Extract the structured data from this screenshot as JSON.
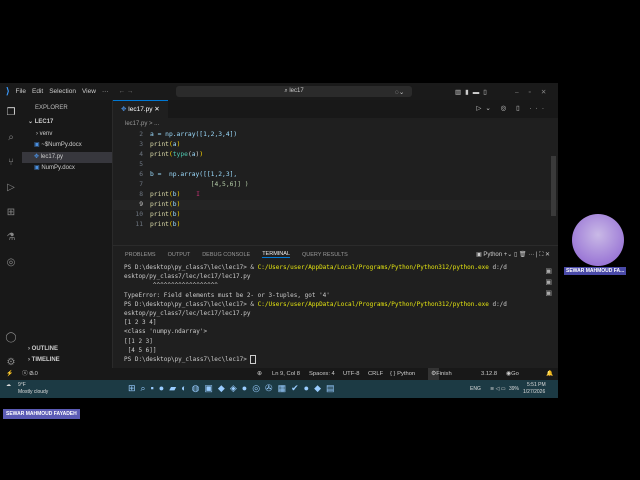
{
  "menu": [
    "File",
    "Edit",
    "Selection",
    "View",
    "···"
  ],
  "search": "lec17",
  "explorer": {
    "title": "EXPLORER",
    "folder": "LEC17",
    "items": [
      "venv",
      "~$NumPy.docx",
      "lec17.py",
      "NumPy.docx"
    ],
    "outline": "OUTLINE",
    "timeline": "TIMELINE"
  },
  "tab": "lec17.py",
  "breadcrumb": "lec17.py > ...",
  "code": [
    {
      "n": "2",
      "t": "a = np.array([1,2,3,4])"
    },
    {
      "n": "3",
      "t": "print(a)"
    },
    {
      "n": "4",
      "t": "print(type(a))"
    },
    {
      "n": "5",
      "t": ""
    },
    {
      "n": "6",
      "t": "b =  np.array([[1,2,3],"
    },
    {
      "n": "7",
      "t": "                [4,5,6]] )"
    },
    {
      "n": "8",
      "t": "print(b)"
    },
    {
      "n": "9",
      "t": "print(b)"
    },
    {
      "n": "10",
      "t": "print(b)"
    },
    {
      "n": "11",
      "t": "print(b)"
    }
  ],
  "panel_tabs": [
    "PROBLEMS",
    "OUTPUT",
    "DEBUG CONSOLE",
    "TERMINAL",
    "QUERY RESULTS"
  ],
  "terminal_shell": "Python",
  "terminal": {
    "l1a": "PS D:\\desktop\\py_class7\\lec\\lec17> & ",
    "l1b": "C:/Users/user/AppData/Local/Programs/Python/Python312/python.exe",
    "l1c": " d:/d",
    "l2": "esktop/py_class7/lec/lec17/lec17.py",
    "l3": "        ^^^^^^^^^^^^^^^^^^",
    "l4": "TypeError: Field elements must be 2- or 3-tuples, got '4'",
    "l5a": "PS D:\\desktop\\py_class7\\lec\\lec17> & ",
    "l5b": "C:/Users/user/AppData/Local/Programs/Python/Python312/python.exe",
    "l5c": " d:/d",
    "l6": "esktop/py_class7/lec/lec17/lec17.py",
    "l7": "[1 2 3 4]",
    "l8": "<class 'numpy.ndarray'>",
    "l9": "[[1 2 3]",
    "l10": " [4 5 6]]",
    "l11": "PS D:\\desktop\\py_class7\\lec\\lec17> "
  },
  "status": {
    "errors": "0",
    "warnings": "0",
    "pos": "Ln 9, Col 8",
    "spaces": "Spaces: 4",
    "enc": "UTF-8",
    "eol": "CRLF",
    "lang": "{ } Python",
    "setup": "Finish Setup",
    "ver": "3.12.8",
    "live": "Go Live"
  },
  "taskbar": {
    "temp": "9°F",
    "weather": "Mostly cloudy",
    "lang": "ENG",
    "battery": "39%",
    "time": "5:51 PM",
    "date": "1/27/2026"
  },
  "participant": "SEWAR MAHMOUD FAYADEH",
  "participant_short": "SEWAR MAHMOUD FA..."
}
